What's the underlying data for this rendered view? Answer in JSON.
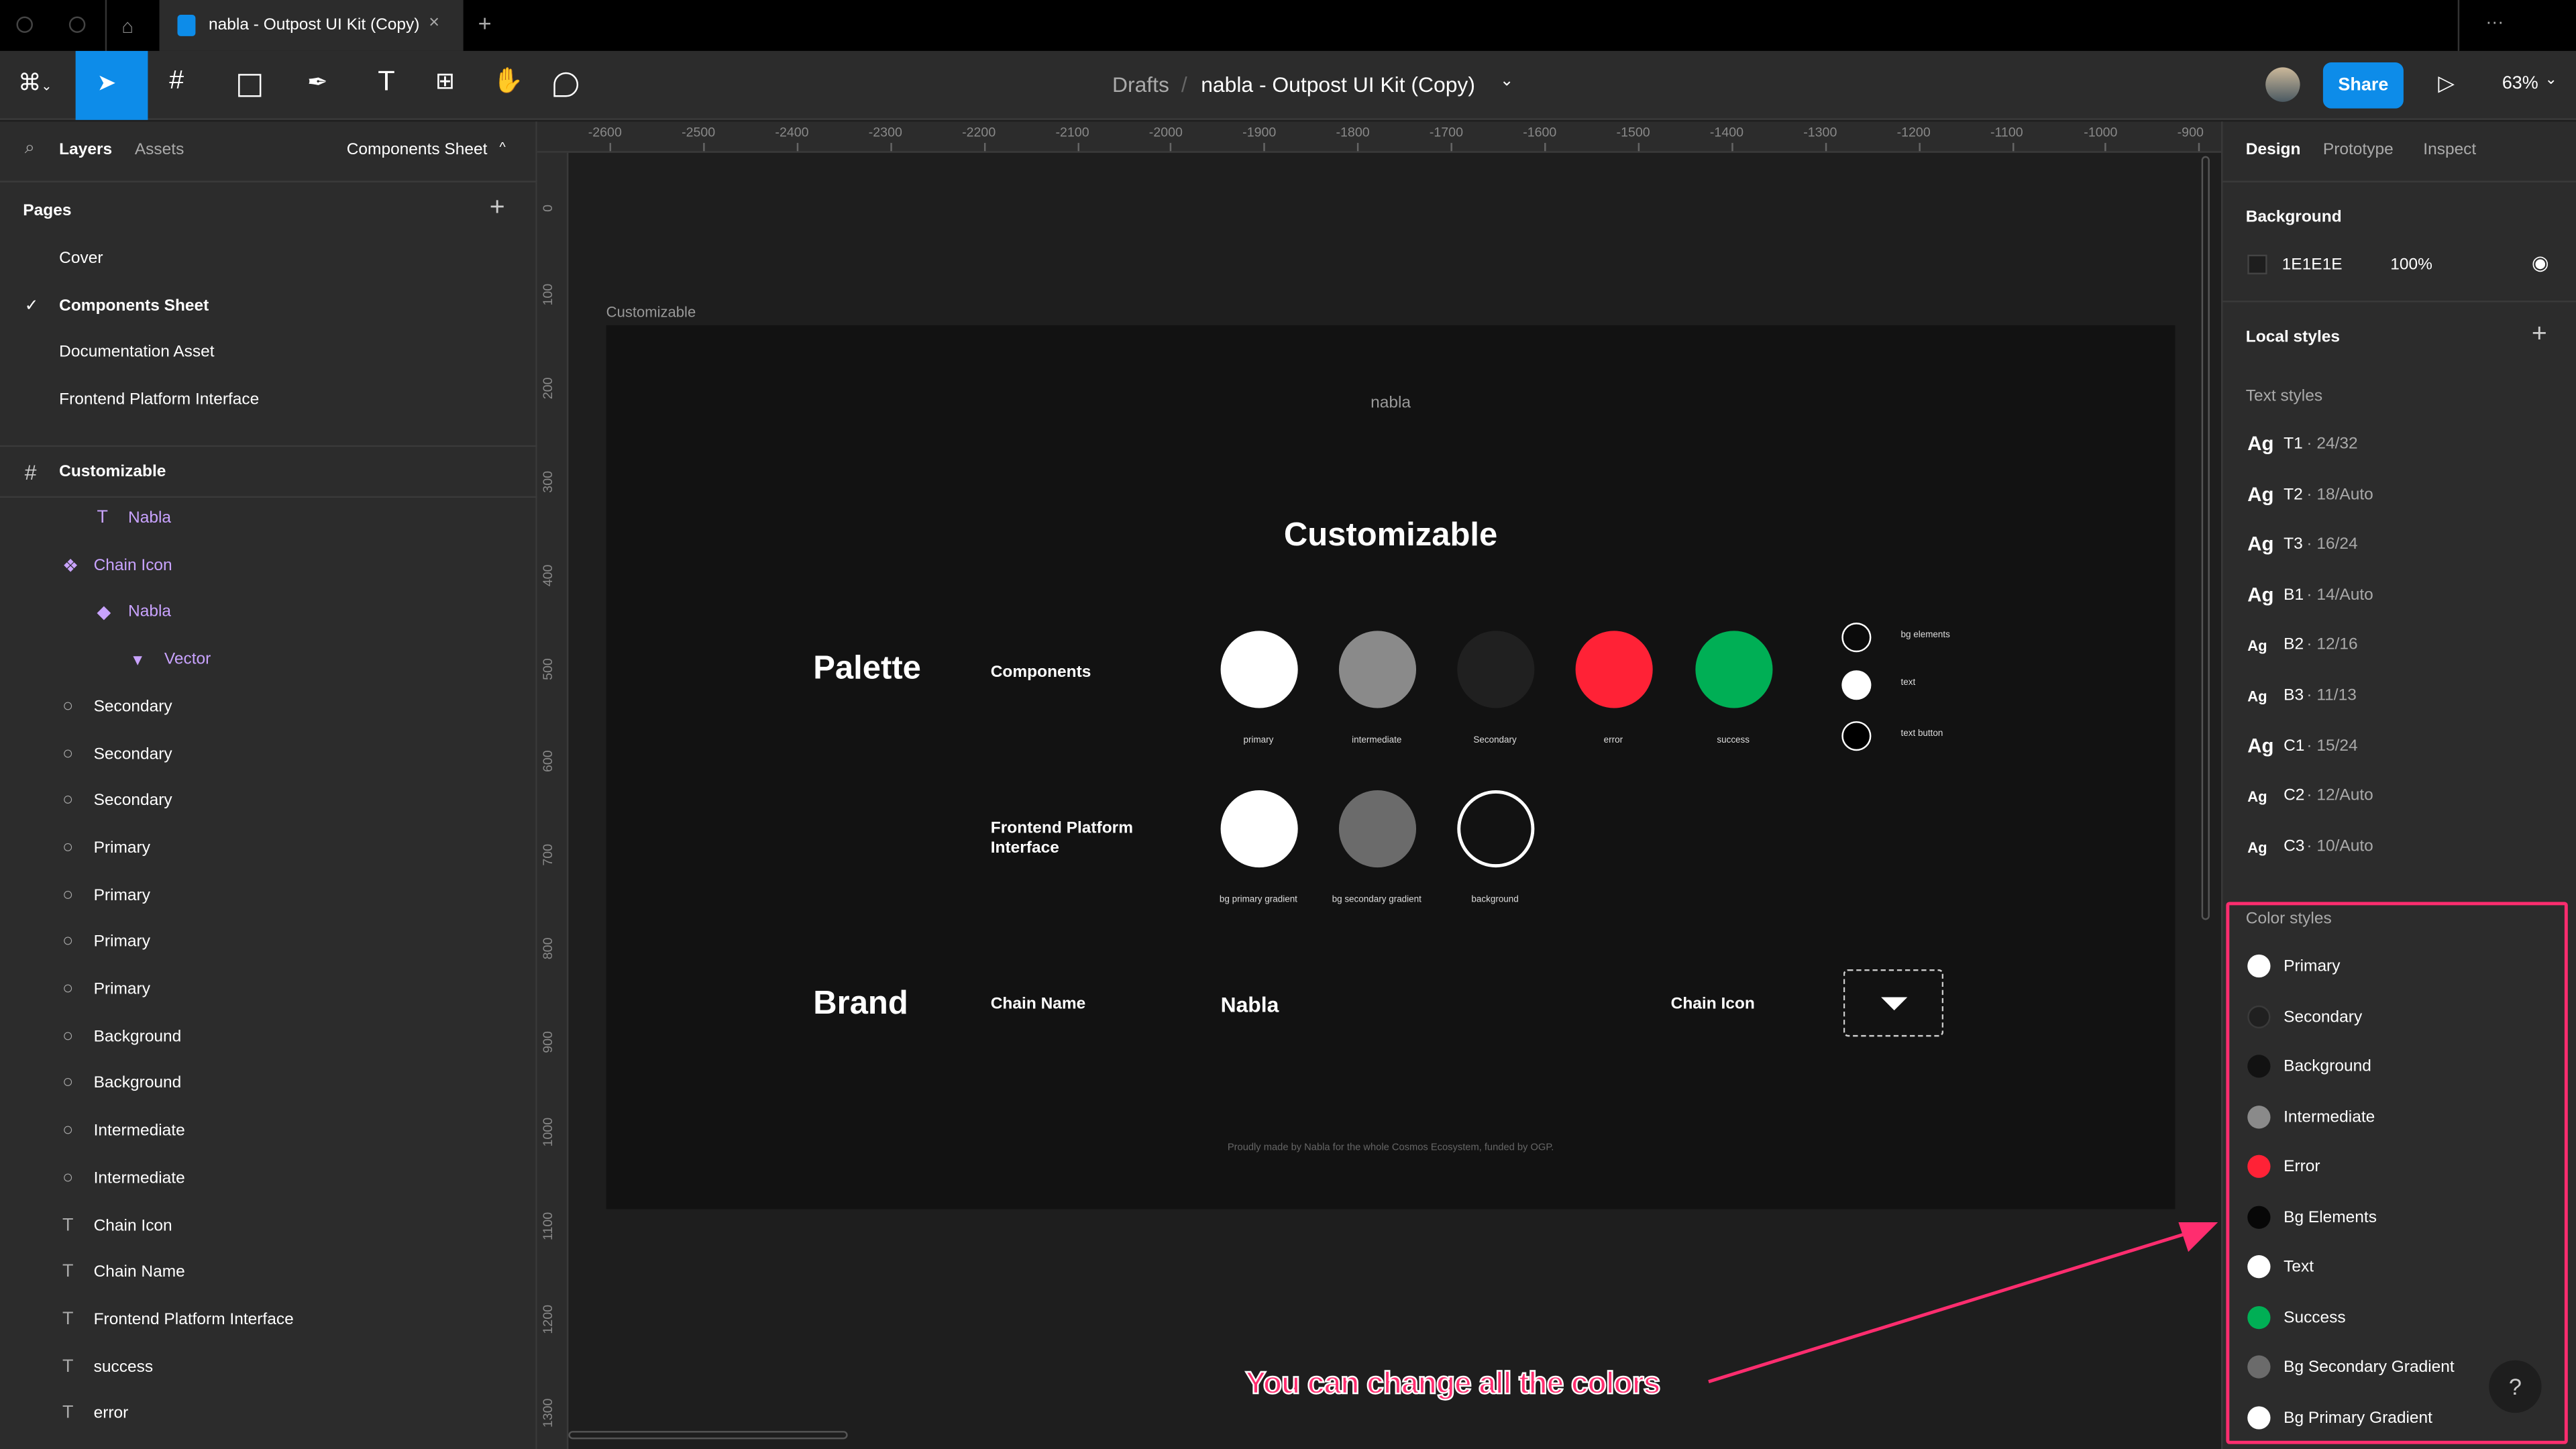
{
  "tab": {
    "title": "nabla - Outpost UI Kit (Copy)",
    "close": "×",
    "new": "+",
    "more": "···"
  },
  "toolbar": {
    "breadcrumb_root": "Drafts",
    "separator": "/",
    "file_name": "nabla - Outpost UI Kit (Copy)",
    "share": "Share",
    "zoom": "63%",
    "active_tool": "move",
    "accent": "#0d8ce9"
  },
  "left_panel": {
    "tabs": [
      "Layers",
      "Assets"
    ],
    "page_selector": "Components Sheet",
    "pages_title": "Pages",
    "pages": [
      {
        "label": "Cover",
        "selected": false
      },
      {
        "label": "Components Sheet",
        "selected": true
      },
      {
        "label": "Documentation Asset",
        "selected": false
      },
      {
        "label": "Frontend Platform Interface",
        "selected": false
      }
    ],
    "frame_layer": "Customizable",
    "layers": [
      {
        "label": "Nabla",
        "icon": "text-icon",
        "depth": 1,
        "purple": true
      },
      {
        "label": "Chain Icon",
        "icon": "component-icon",
        "depth": 0,
        "purple": true
      },
      {
        "label": "Nabla",
        "icon": "instance-icon",
        "depth": 1,
        "purple": true
      },
      {
        "label": "Vector",
        "icon": "vector-icon",
        "depth": 2,
        "purple": true
      },
      {
        "label": "Secondary",
        "icon": "ellipse-icon",
        "depth": 0
      },
      {
        "label": "Secondary",
        "icon": "ellipse-icon",
        "depth": 0
      },
      {
        "label": "Secondary",
        "icon": "ellipse-icon",
        "depth": 0
      },
      {
        "label": "Primary",
        "icon": "ellipse-icon",
        "depth": 0
      },
      {
        "label": "Primary",
        "icon": "ellipse-icon",
        "depth": 0
      },
      {
        "label": "Primary",
        "icon": "ellipse-icon",
        "depth": 0
      },
      {
        "label": "Primary",
        "icon": "ellipse-icon",
        "depth": 0
      },
      {
        "label": "Background",
        "icon": "ellipse-icon",
        "depth": 0
      },
      {
        "label": "Background",
        "icon": "ellipse-icon",
        "depth": 0
      },
      {
        "label": "Intermediate",
        "icon": "ellipse-icon",
        "depth": 0
      },
      {
        "label": "Intermediate",
        "icon": "ellipse-icon",
        "depth": 0
      },
      {
        "label": "Chain Icon",
        "icon": "text-icon",
        "depth": 0
      },
      {
        "label": "Chain Name",
        "icon": "text-icon",
        "depth": 0
      },
      {
        "label": "Frontend Platform Interface",
        "icon": "text-icon",
        "depth": 0
      },
      {
        "label": "success",
        "icon": "text-icon",
        "depth": 0
      },
      {
        "label": "error",
        "icon": "text-icon",
        "depth": 0
      }
    ]
  },
  "rulers": {
    "top": [
      "-2600",
      "-2500",
      "-2400",
      "-2300",
      "-2200",
      "-2100",
      "-2000",
      "-1900",
      "-1800",
      "-1700",
      "-1600",
      "-1500",
      "-1400",
      "-1300",
      "-1200",
      "-1100",
      "-1000",
      "-900"
    ],
    "left": [
      "0",
      "100",
      "200",
      "300",
      "400",
      "500",
      "600",
      "700",
      "800",
      "900",
      "1000",
      "1100",
      "1200",
      "1300"
    ]
  },
  "canvas": {
    "frame_label": "Customizable",
    "logo": "nabla",
    "title": "Customizable",
    "palette": "Palette",
    "components_label": "Components",
    "components": [
      {
        "label": "primary",
        "color": "#ffffff"
      },
      {
        "label": "intermediate",
        "color": "#8a8a8a"
      },
      {
        "label": "Secondary",
        "color": "#202020"
      },
      {
        "label": "error",
        "color": "#ff2236"
      },
      {
        "label": "success",
        "color": "#00af55"
      }
    ],
    "small": [
      {
        "label": "bg elements",
        "color": "#0b0b0b",
        "ring": true
      },
      {
        "label": "text",
        "color": "#ffffff",
        "ring": false
      },
      {
        "label": "text button",
        "color": "#000000",
        "ring": true
      }
    ],
    "fpi_label": "Frontend Platform Interface",
    "fpi": [
      {
        "label": "bg primary gradient",
        "color": "#ffffff",
        "ring": false
      },
      {
        "label": "bg secondary gradient",
        "color": "#6b6b6b",
        "ring": false
      },
      {
        "label": "background",
        "color": "#121212",
        "ring": true
      }
    ],
    "brand": "Brand",
    "chain_name_label": "Chain Name",
    "chain_name": "Nabla",
    "chain_icon_label": "Chain Icon",
    "footer": "Proudly made by Nabla for the whole Cosmos Ecosystem, funded by OGP.",
    "annotation": "You can change all the colors",
    "annotation_color": "#ff2d6f"
  },
  "right_panel": {
    "tabs": [
      "Design",
      "Prototype",
      "Inspect"
    ],
    "background_title": "Background",
    "bg_hex": "1E1E1E",
    "bg_opacity": "100%",
    "local_styles": "Local styles",
    "text_styles_title": "Text styles",
    "text_styles": [
      {
        "ag": "Ag",
        "name": "T1",
        "spec": " · 24/32",
        "big": true
      },
      {
        "ag": "Ag",
        "name": "T2",
        "spec": " · 18/Auto",
        "big": true
      },
      {
        "ag": "Ag",
        "name": "T3",
        "spec": " · 16/24",
        "big": true
      },
      {
        "ag": "Ag",
        "name": "B1",
        "spec": " · 14/Auto",
        "big": true
      },
      {
        "ag": "Ag",
        "name": "B2",
        "spec": " · 12/16",
        "big": false
      },
      {
        "ag": "Ag",
        "name": "B3",
        "spec": " · 11/13",
        "big": false
      },
      {
        "ag": "Ag",
        "name": "C1",
        "spec": " · 15/24",
        "big": true
      },
      {
        "ag": "Ag",
        "name": "C2",
        "spec": " · 12/Auto",
        "big": false
      },
      {
        "ag": "Ag",
        "name": "C3",
        "spec": " · 10/Auto",
        "big": false
      }
    ],
    "color_styles_title": "Color styles",
    "color_styles": [
      {
        "name": "Primary",
        "color": "#ffffff"
      },
      {
        "name": "Secondary",
        "color": "#202020"
      },
      {
        "name": "Background",
        "color": "#121212"
      },
      {
        "name": "Intermediate",
        "color": "#8a8a8a"
      },
      {
        "name": "Error",
        "color": "#ff2236"
      },
      {
        "name": "Bg Elements",
        "color": "#070707"
      },
      {
        "name": "Text",
        "color": "#ffffff"
      },
      {
        "name": "Success",
        "color": "#00af55"
      },
      {
        "name": "Bg Secondary Gradient",
        "color": "#6b6b6b"
      },
      {
        "name": "Bg Primary Gradient",
        "color": "#ffffff"
      }
    ],
    "help": "?"
  }
}
